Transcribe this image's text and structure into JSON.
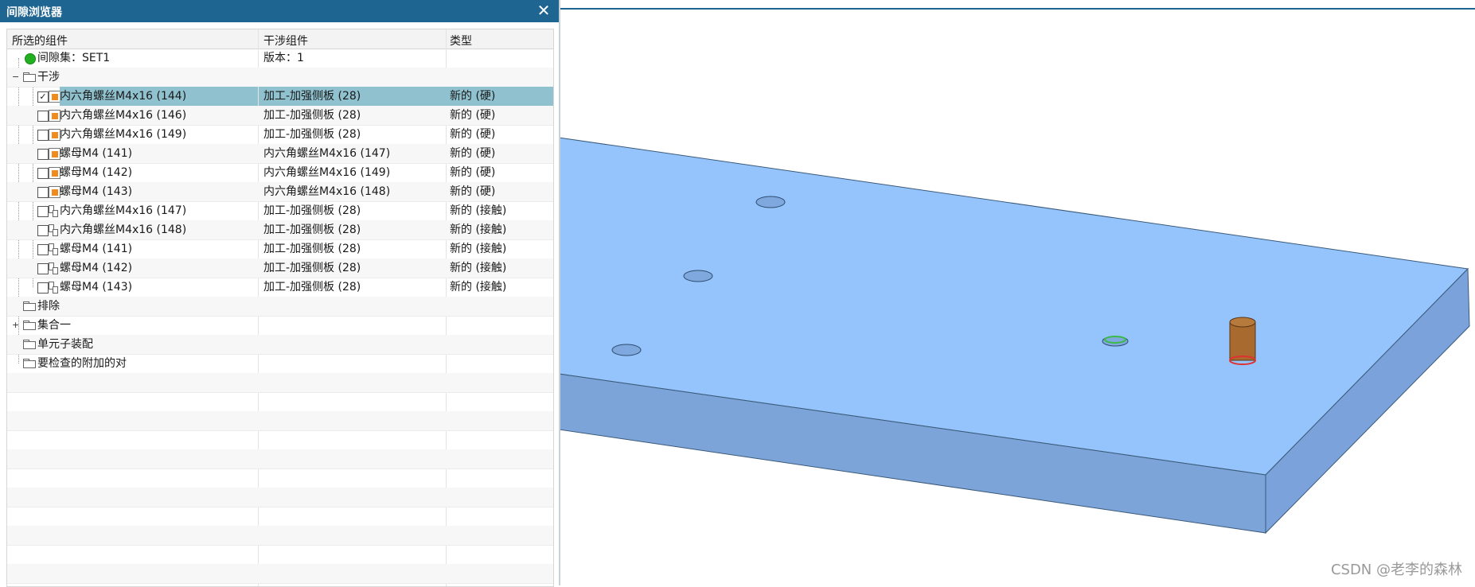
{
  "window": {
    "title": "间隙浏览器"
  },
  "table": {
    "headers": {
      "selected": "所选的组件",
      "interfering": "干涉组件",
      "type": "类型"
    },
    "set_row": {
      "label": "间隙集：SET1",
      "version": "版本：1"
    },
    "interference_folder": "干涉",
    "interferences": [
      {
        "name": "内六角螺丝M4x16 (144)",
        "other": "加工-加强侧板 (28)",
        "type": "新的 (硬)",
        "kind": "hard",
        "checked": true,
        "selected": true
      },
      {
        "name": "内六角螺丝M4x16 (146)",
        "other": "加工-加强侧板 (28)",
        "type": "新的 (硬)",
        "kind": "hard",
        "checked": false,
        "selected": false
      },
      {
        "name": "内六角螺丝M4x16 (149)",
        "other": "加工-加强侧板 (28)",
        "type": "新的 (硬)",
        "kind": "hard",
        "checked": false,
        "selected": false
      },
      {
        "name": "螺母M4 (141)",
        "other": "内六角螺丝M4x16 (147)",
        "type": "新的 (硬)",
        "kind": "hard",
        "checked": false,
        "selected": false
      },
      {
        "name": "螺母M4 (142)",
        "other": "内六角螺丝M4x16 (149)",
        "type": "新的 (硬)",
        "kind": "hard",
        "checked": false,
        "selected": false
      },
      {
        "name": "螺母M4 (143)",
        "other": "内六角螺丝M4x16 (148)",
        "type": "新的 (硬)",
        "kind": "hard",
        "checked": false,
        "selected": false
      },
      {
        "name": "内六角螺丝M4x16 (147)",
        "other": "加工-加强侧板 (28)",
        "type": "新的 (接触)",
        "kind": "touch",
        "checked": false,
        "selected": false
      },
      {
        "name": "内六角螺丝M4x16 (148)",
        "other": "加工-加强侧板 (28)",
        "type": "新的 (接触)",
        "kind": "touch",
        "checked": false,
        "selected": false
      },
      {
        "name": "螺母M4 (141)",
        "other": "加工-加强侧板 (28)",
        "type": "新的 (接触)",
        "kind": "touch",
        "checked": false,
        "selected": false
      },
      {
        "name": "螺母M4 (142)",
        "other": "加工-加强侧板 (28)",
        "type": "新的 (接触)",
        "kind": "touch",
        "checked": false,
        "selected": false
      },
      {
        "name": "螺母M4 (143)",
        "other": "加工-加强侧板 (28)",
        "type": "新的 (接触)",
        "kind": "touch",
        "checked": false,
        "selected": false
      }
    ],
    "folders": [
      {
        "label": "排除",
        "expander": ""
      },
      {
        "label": "集合一",
        "expander": "+"
      },
      {
        "label": "单元子装配",
        "expander": ""
      },
      {
        "label": "要检查的附加的对",
        "expander": ""
      }
    ]
  },
  "watermark": "CSDN @老李的森林",
  "colors": {
    "plate_top": "#94c4fb",
    "plate_front": "#7da4d8",
    "plate_side": "#7ba2db",
    "titlebar": "#1e6592",
    "highlight": "#8fc1cf",
    "bolt": "#a86a2e"
  }
}
